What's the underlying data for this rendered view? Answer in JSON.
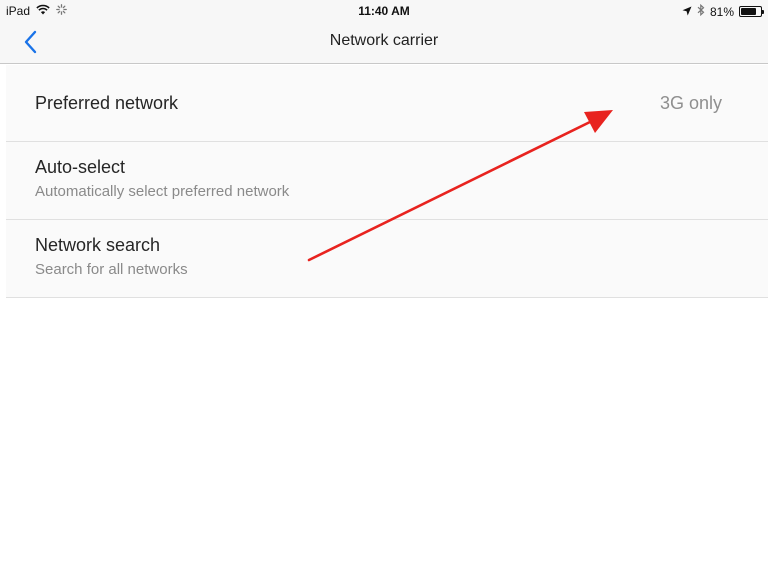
{
  "status_bar": {
    "device": "iPad",
    "time": "11:40 AM",
    "battery_percent": "81%",
    "battery_level": 0.81,
    "icons": [
      "wifi-icon",
      "activity-spinner-icon",
      "location-arrow-icon",
      "bluetooth-icon",
      "battery-icon"
    ]
  },
  "nav": {
    "title": "Network carrier",
    "back_icon": "chevron-left-icon",
    "accent_color": "#1a73e8"
  },
  "settings": {
    "preferred_network": {
      "title": "Preferred network",
      "value": "3G only"
    },
    "auto_select": {
      "title": "Auto-select",
      "subtitle": "Automatically select preferred network"
    },
    "network_search": {
      "title": "Network search",
      "subtitle": "Search for all networks"
    }
  },
  "annotation": {
    "color": "#e8231f",
    "icon": "red-arrow-annotation"
  }
}
